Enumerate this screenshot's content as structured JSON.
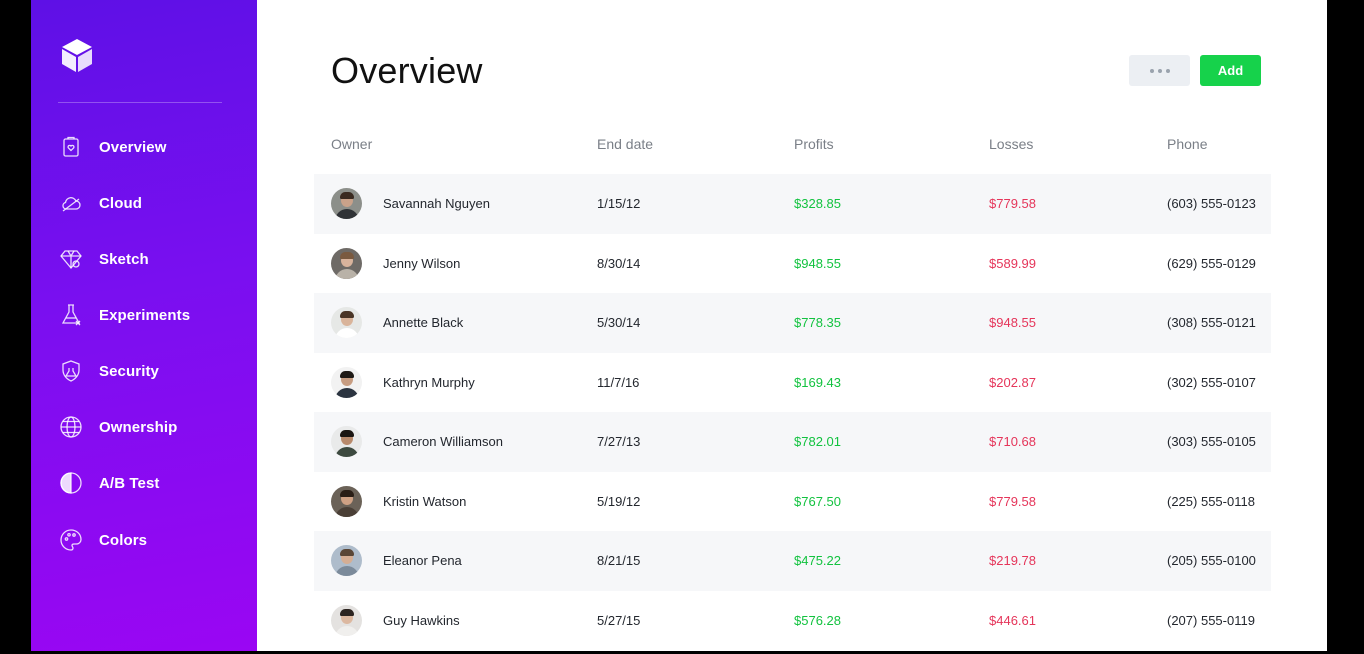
{
  "sidebar": {
    "logo": "cube-logo",
    "items": [
      {
        "label": "Overview",
        "icon": "clipboard-heart-icon"
      },
      {
        "label": "Cloud",
        "icon": "cloud-icon"
      },
      {
        "label": "Sketch",
        "icon": "diamond-icon"
      },
      {
        "label": "Experiments",
        "icon": "flask-icon"
      },
      {
        "label": "Security",
        "icon": "shield-icon"
      },
      {
        "label": "Ownership",
        "icon": "globe-icon"
      },
      {
        "label": "A/B Test",
        "icon": "half-circle-icon"
      },
      {
        "label": "Colors",
        "icon": "palette-icon"
      }
    ]
  },
  "header": {
    "title": "Overview",
    "more_label": "more-dots-icon",
    "add_label": "Add"
  },
  "table": {
    "columns": [
      "Owner",
      "End date",
      "Profits",
      "Losses",
      "Phone"
    ],
    "rows": [
      {
        "owner": "Savannah Nguyen",
        "end_date": "1/15/12",
        "profit": "$328.85",
        "loss": "$779.58",
        "phone": "(603) 555-0123"
      },
      {
        "owner": "Jenny Wilson",
        "end_date": "8/30/14",
        "profit": "$948.55",
        "loss": "$589.99",
        "phone": "(629) 555-0129"
      },
      {
        "owner": "Annette Black",
        "end_date": "5/30/14",
        "profit": "$778.35",
        "loss": "$948.55",
        "phone": "(308) 555-0121"
      },
      {
        "owner": "Kathryn Murphy",
        "end_date": "11/7/16",
        "profit": "$169.43",
        "loss": "$202.87",
        "phone": "(302) 555-0107"
      },
      {
        "owner": "Cameron Williamson",
        "end_date": "7/27/13",
        "profit": "$782.01",
        "loss": "$710.68",
        "phone": "(303) 555-0105"
      },
      {
        "owner": "Kristin Watson",
        "end_date": "5/19/12",
        "profit": "$767.50",
        "loss": "$779.58",
        "phone": "(225) 555-0118"
      },
      {
        "owner": "Eleanor Pena",
        "end_date": "8/21/15",
        "profit": "$475.22",
        "loss": "$219.78",
        "phone": "(205) 555-0100"
      },
      {
        "owner": "Guy Hawkins",
        "end_date": "5/27/15",
        "profit": "$576.28",
        "loss": "$446.61",
        "phone": "(207) 555-0119"
      }
    ]
  },
  "colors": {
    "accent": "#16d24b",
    "profit": "#12c23f",
    "loss": "#e5355a",
    "sidebar_top": "#5e10e6",
    "sidebar_bottom": "#9a06f3"
  }
}
